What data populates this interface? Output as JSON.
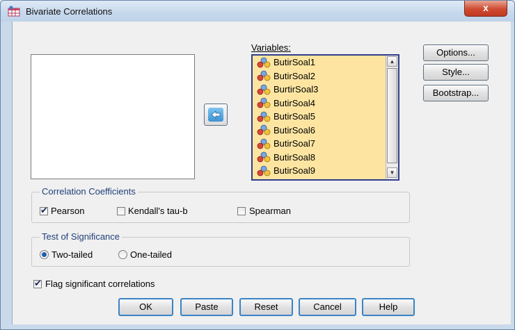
{
  "window": {
    "title": "Bivariate Correlations",
    "close_glyph": "x"
  },
  "variables": {
    "label": "Variables:",
    "items": [
      {
        "name": "ButirSoal1",
        "icon": "scale-variable-icon"
      },
      {
        "name": "ButirSoal2",
        "icon": "scale-variable-icon"
      },
      {
        "name": "BurtirSoal3",
        "icon": "scale-variable-icon"
      },
      {
        "name": "ButirSoal4",
        "icon": "scale-variable-icon"
      },
      {
        "name": "ButirSoal5",
        "icon": "scale-variable-icon"
      },
      {
        "name": "ButirSoal6",
        "icon": "scale-variable-icon"
      },
      {
        "name": "ButirSoal7",
        "icon": "scale-variable-icon"
      },
      {
        "name": "ButirSoal8",
        "icon": "scale-variable-icon"
      },
      {
        "name": "ButirSoal9",
        "icon": "scale-variable-icon"
      }
    ]
  },
  "side_buttons": {
    "options": "Options...",
    "style": "Style...",
    "bootstrap": "Bootstrap..."
  },
  "coefficients": {
    "title": "Correlation Coefficients",
    "pearson": {
      "label": "Pearson",
      "checked": true
    },
    "kendall": {
      "label": "Kendall's tau-b",
      "checked": false
    },
    "spearman": {
      "label": "Spearman",
      "checked": false
    }
  },
  "significance": {
    "title": "Test of Significance",
    "two_tailed": {
      "label": "Two-tailed",
      "selected": true
    },
    "one_tailed": {
      "label": "One-tailed",
      "selected": false
    }
  },
  "flag": {
    "label": "Flag significant correlations",
    "checked": true
  },
  "buttons": {
    "ok": "OK",
    "paste": "Paste",
    "reset": "Reset",
    "cancel": "Cancel",
    "help": "Help"
  },
  "colors": {
    "list_highlight": "#fde5a1",
    "accent": "#3b83c6",
    "close": "#c03a22"
  }
}
